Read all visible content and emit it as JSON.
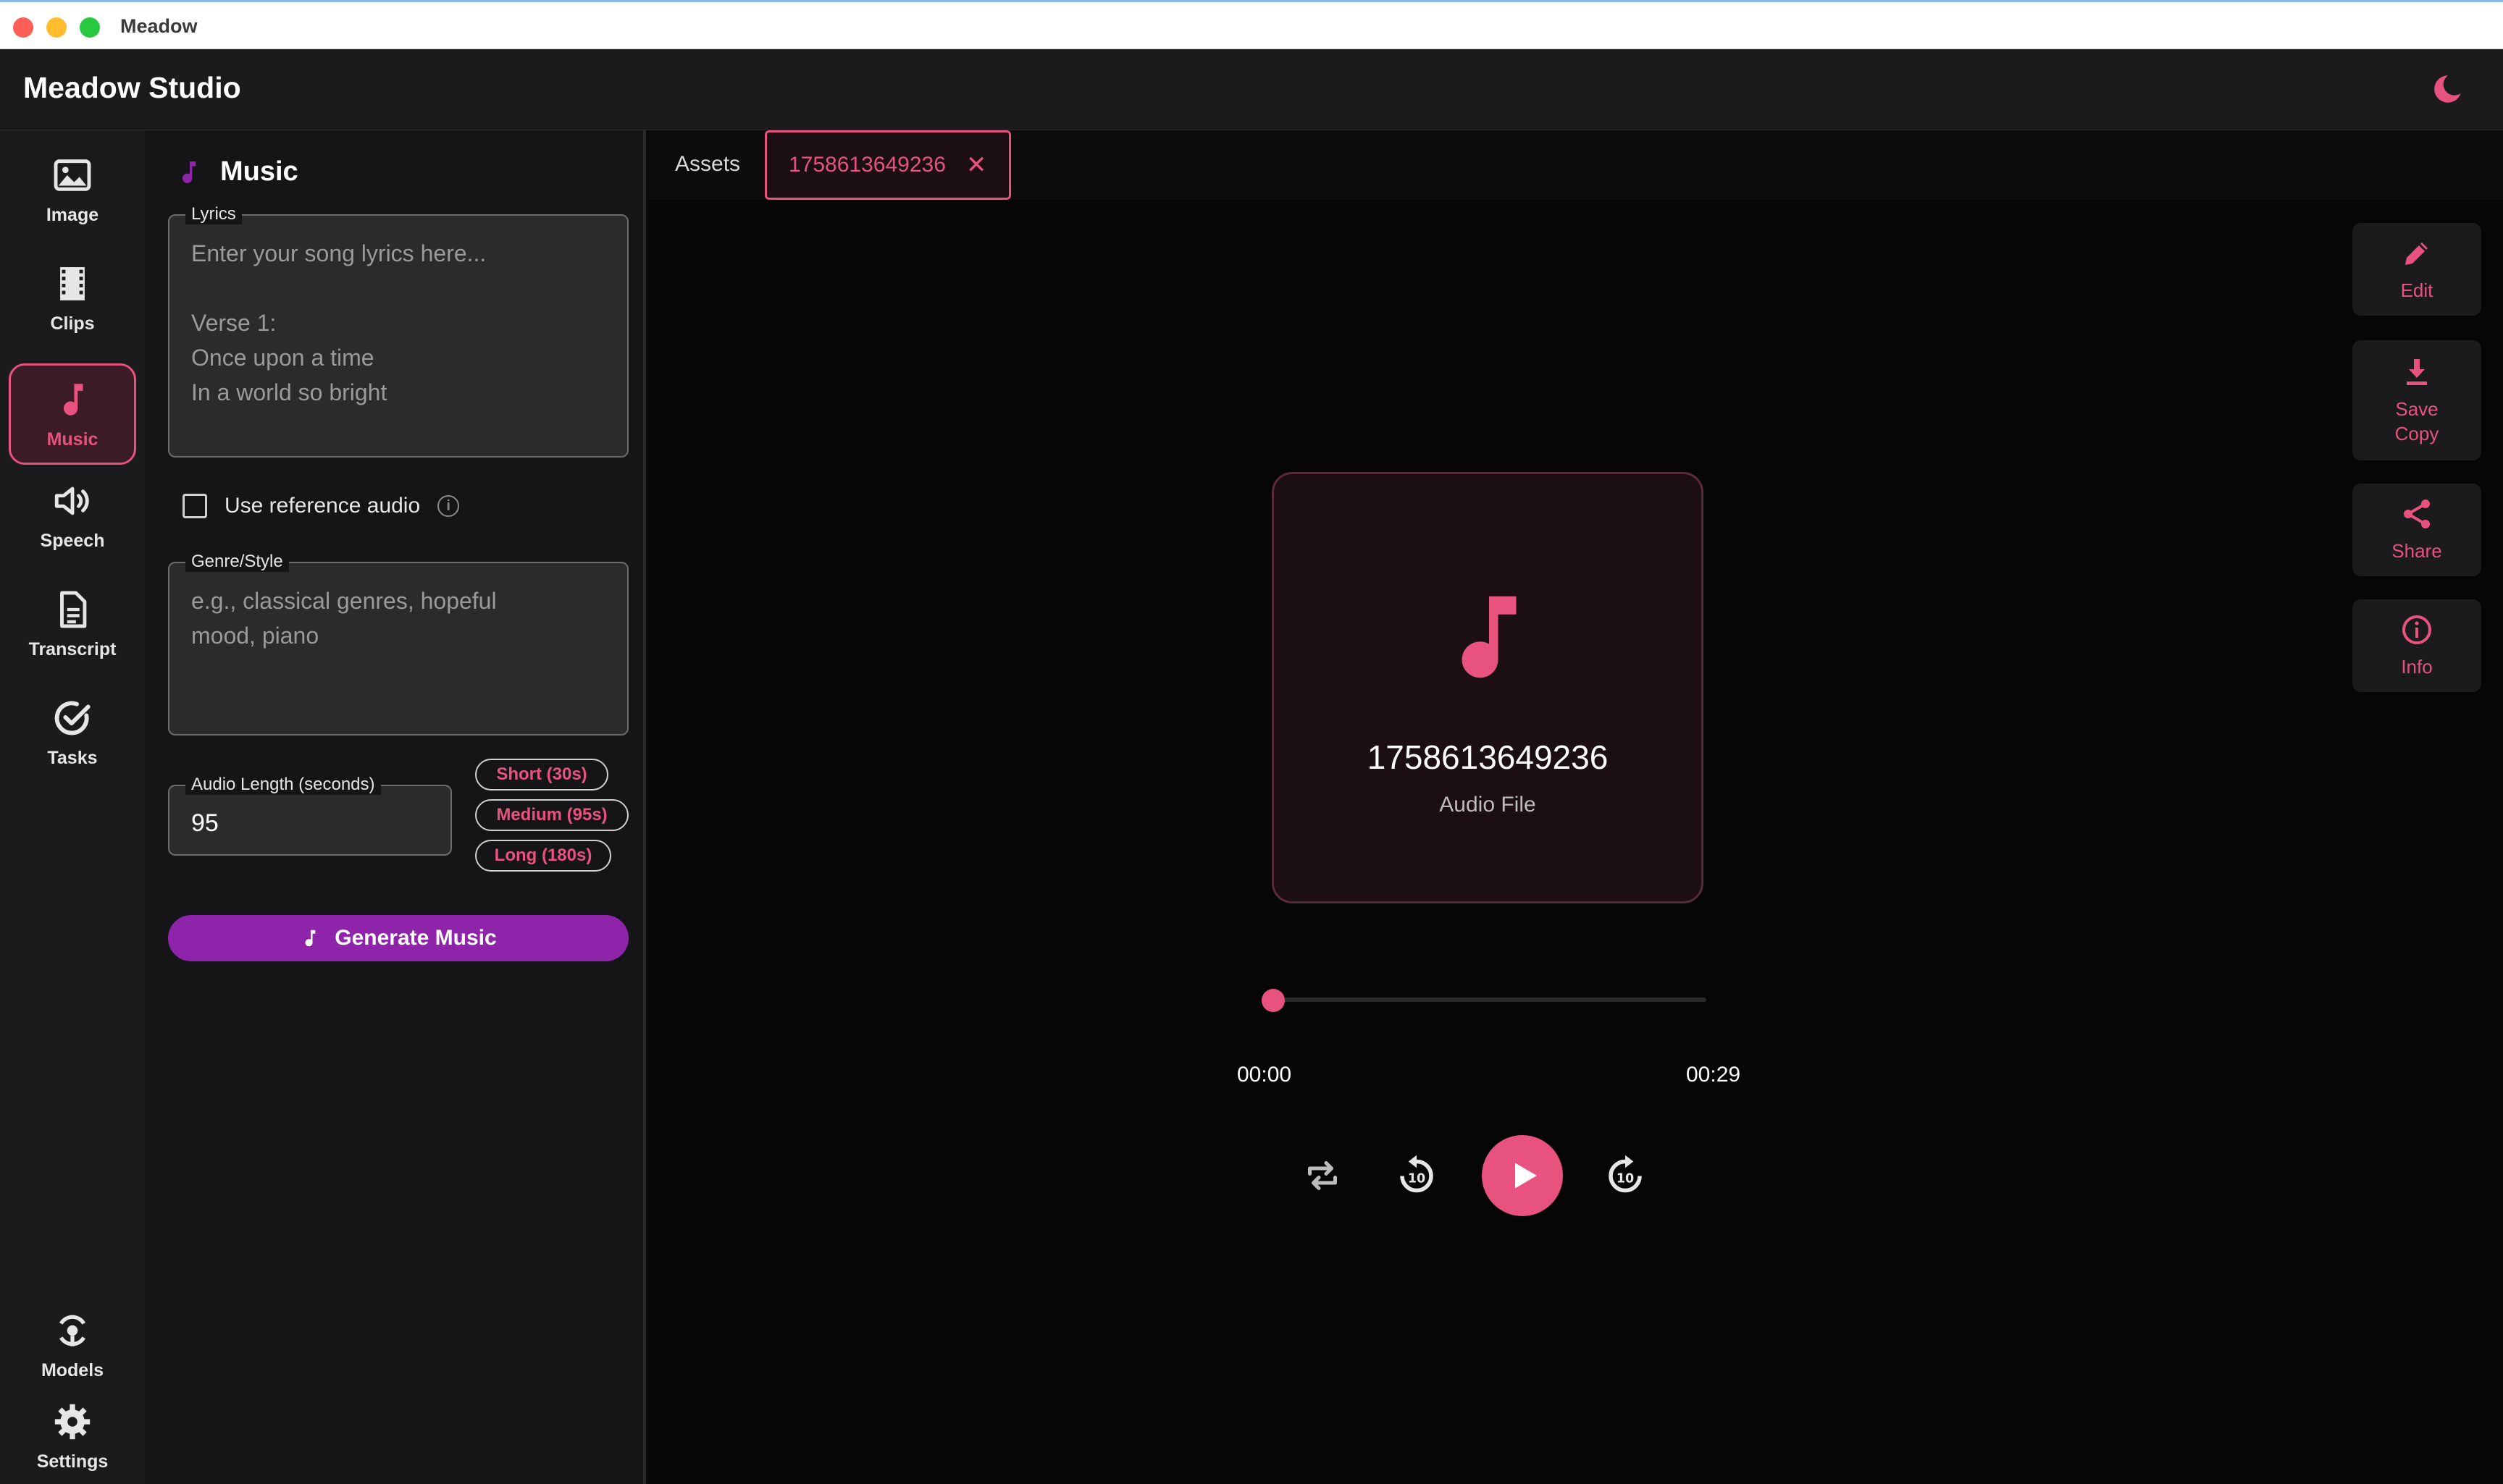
{
  "window": {
    "title": "Meadow"
  },
  "header": {
    "app_title": "Meadow Studio"
  },
  "nav": {
    "items": [
      {
        "label": "Image",
        "icon": "image-icon"
      },
      {
        "label": "Clips",
        "icon": "film-icon"
      },
      {
        "label": "Music",
        "icon": "music-note-icon",
        "active": true
      },
      {
        "label": "Speech",
        "icon": "speaker-icon"
      },
      {
        "label": "Transcript",
        "icon": "document-icon"
      },
      {
        "label": "Tasks",
        "icon": "check-circle-icon"
      }
    ],
    "bottom": [
      {
        "label": "Models",
        "icon": "models-icon"
      },
      {
        "label": "Settings",
        "icon": "gear-icon"
      }
    ]
  },
  "music_panel": {
    "title": "Music",
    "lyrics": {
      "label": "Lyrics",
      "placeholder": "Enter your song lyrics here...\n\nVerse 1:\nOnce upon a time\nIn a world so bright"
    },
    "reference_audio": {
      "label": "Use reference audio",
      "checked": false
    },
    "genre": {
      "label": "Genre/Style",
      "placeholder": "e.g., classical genres, hopeful\nmood, piano"
    },
    "audio_length": {
      "label": "Audio Length (seconds)",
      "value": "95"
    },
    "presets": [
      "Short (30s)",
      "Medium (95s)",
      "Long (180s)"
    ],
    "generate_label": "Generate Music"
  },
  "tabs": {
    "assets_label": "Assets",
    "active_label": "1758613649236"
  },
  "player": {
    "file_name": "1758613649236",
    "file_type": "Audio File",
    "current_time": "00:00",
    "duration": "00:29",
    "progress": 0
  },
  "actions": [
    {
      "label": "Edit",
      "icon": "pencil-icon"
    },
    {
      "label": "Save\nCopy",
      "icon": "download-icon"
    },
    {
      "label": "Share",
      "icon": "share-icon"
    },
    {
      "label": "Info",
      "icon": "info-icon"
    }
  ],
  "colors": {
    "accent": "#e8527f",
    "purple": "#8e24aa",
    "active_bg": "#3a1b26"
  }
}
